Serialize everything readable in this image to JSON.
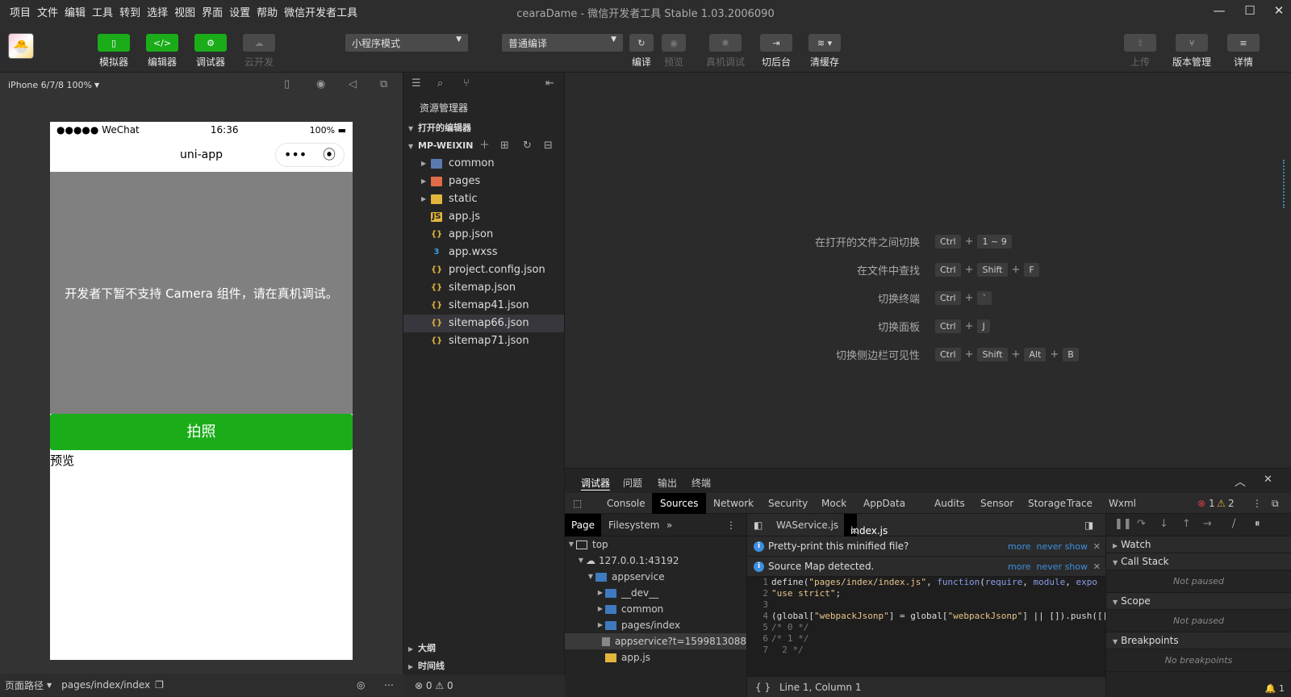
{
  "menu": [
    "项目",
    "文件",
    "编辑",
    "工具",
    "转到",
    "选择",
    "视图",
    "界面",
    "设置",
    "帮助",
    "微信开发者工具"
  ],
  "window": {
    "title": "cearaDame - 微信开发者工具 Stable 1.03.2006090"
  },
  "toolbar": {
    "simulator": "模拟器",
    "editor": "编辑器",
    "debugger": "调试器",
    "cloud": "云开发",
    "mode_select": "小程序模式",
    "compile_select": "普通编译",
    "compile": "编译",
    "preview": "预览",
    "remote_debug": "真机调试",
    "background": "切后台",
    "clear_cache": "清缓存",
    "upload": "上传",
    "version": "版本管理",
    "details": "详情"
  },
  "simulator": {
    "device": "iPhone 6/7/8 100%",
    "status": {
      "carrier": "●●●●● WeChat",
      "time": "16:36",
      "battery": "100%"
    },
    "nav_title": "uni-app",
    "camera_notice": "开发者下暂不支持 Camera 组件，请在真机调试。",
    "shoot_button": "拍照",
    "preview_text": "预览",
    "footer_path_label": "页面路径",
    "footer_path": "pages/index/index"
  },
  "explorer": {
    "title": "资源管理器",
    "open_editors": "打开的编辑器",
    "project": "MP-WEIXIN",
    "files": [
      {
        "name": "common",
        "type": "folder"
      },
      {
        "name": "pages",
        "type": "folder"
      },
      {
        "name": "static",
        "type": "folder"
      },
      {
        "name": "app.js",
        "type": "js"
      },
      {
        "name": "app.json",
        "type": "json"
      },
      {
        "name": "app.wxss",
        "type": "wxss"
      },
      {
        "name": "project.config.json",
        "type": "json"
      },
      {
        "name": "sitemap.json",
        "type": "json"
      },
      {
        "name": "sitemap41.json",
        "type": "json"
      },
      {
        "name": "sitemap66.json",
        "type": "json"
      },
      {
        "name": "sitemap71.json",
        "type": "json"
      }
    ],
    "outline": "大纲",
    "timeline": "时间线",
    "errors": "0",
    "warnings": "0"
  },
  "editor_hints": [
    {
      "label": "在打开的文件之间切换",
      "keys": [
        "Ctrl",
        "1 ~ 9"
      ]
    },
    {
      "label": "在文件中查找",
      "keys": [
        "Ctrl",
        "Shift",
        "F"
      ]
    },
    {
      "label": "切换终端",
      "keys": [
        "Ctrl",
        "`"
      ]
    },
    {
      "label": "切换面板",
      "keys": [
        "Ctrl",
        "J"
      ]
    },
    {
      "label": "切换侧边栏可见性",
      "keys": [
        "Ctrl",
        "Shift",
        "Alt",
        "B"
      ]
    }
  ],
  "debug": {
    "tabs": [
      "调试器",
      "问题",
      "输出",
      "终端"
    ],
    "devtabs": [
      "Console",
      "Sources",
      "Network",
      "Security",
      "Mock",
      "AppData",
      "Audits",
      "Sensor",
      "Storage",
      "Trace",
      "Wxml"
    ],
    "error_count": "1",
    "warn_count": "2",
    "page_tabs": [
      "Page",
      "Filesystem"
    ],
    "tree": [
      "top",
      "127.0.0.1:43192",
      "appservice",
      "__dev__",
      "common",
      "pages/index",
      "appservice?t=1599813088",
      "app.js"
    ],
    "code_tabs": [
      "WAService.js",
      "index.js"
    ],
    "banner1": "Pretty-print this minified file?",
    "banner2": "Source Map detected.",
    "more": "more",
    "never_show": "never show",
    "cursor": "Line 1, Column 1",
    "watch": "Watch",
    "call_stack": "Call Stack",
    "not_paused": "Not paused",
    "scope": "Scope",
    "breakpoints": "Breakpoints",
    "no_breakpoints": "No breakpoints",
    "bell_count": "1"
  }
}
